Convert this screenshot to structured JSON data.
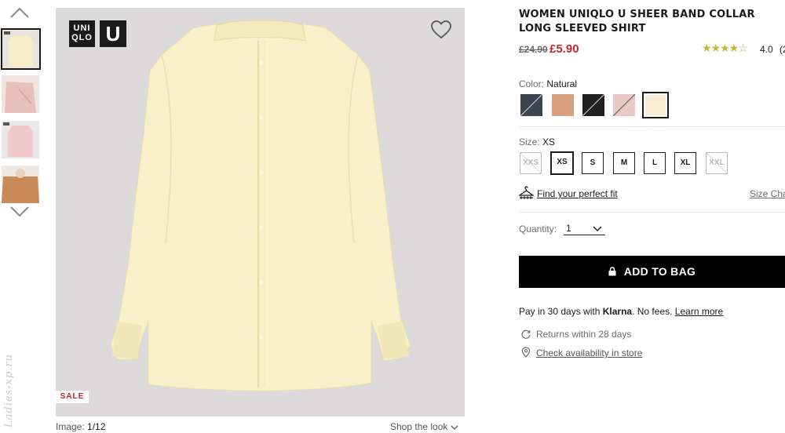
{
  "gallery": {
    "counter_label": "Image:",
    "counter_value": "1/12",
    "shop_the_look": "Shop the look",
    "sale_badge": "SALE",
    "logo_top": "UNI",
    "logo_bottom": "QLO",
    "logo_u": "U",
    "watermark": "Ladies-xp.ru"
  },
  "product": {
    "title": "WOMEN UNIQLO U SHEER BAND COLLAR LONG SLEEVED SHIRT",
    "price_old": "£24.90",
    "price_new": "£5.90",
    "stars": "★★★★☆",
    "rating": "4.0",
    "rating_count": "(2"
  },
  "color": {
    "label": "Color:",
    "selected": "Natural",
    "swatches": [
      "#3c4450",
      "#d9a07f",
      "#202020",
      "#e9c9c4",
      "#f6edd2"
    ]
  },
  "size": {
    "label": "Size:",
    "selected": "XS",
    "options": [
      "XXS",
      "XS",
      "S",
      "M",
      "L",
      "XL",
      "XXL"
    ],
    "fit_link": "Find your perfect fit",
    "size_chart": "Size Cha"
  },
  "quantity": {
    "label": "Quantity:",
    "value": "1"
  },
  "cart": {
    "add_label": "ADD TO BAG"
  },
  "payment": {
    "pre": "Pay in 30 days with ",
    "brand": "Klarna",
    "mid": ". No fees. ",
    "link": "Learn more"
  },
  "services": {
    "returns": "Returns within 28 days",
    "store": "Check availability in store"
  },
  "colors": {
    "sale_red": "#c0272d",
    "star_gold": "#c8b53a",
    "image_bg": "#dcdadb"
  }
}
